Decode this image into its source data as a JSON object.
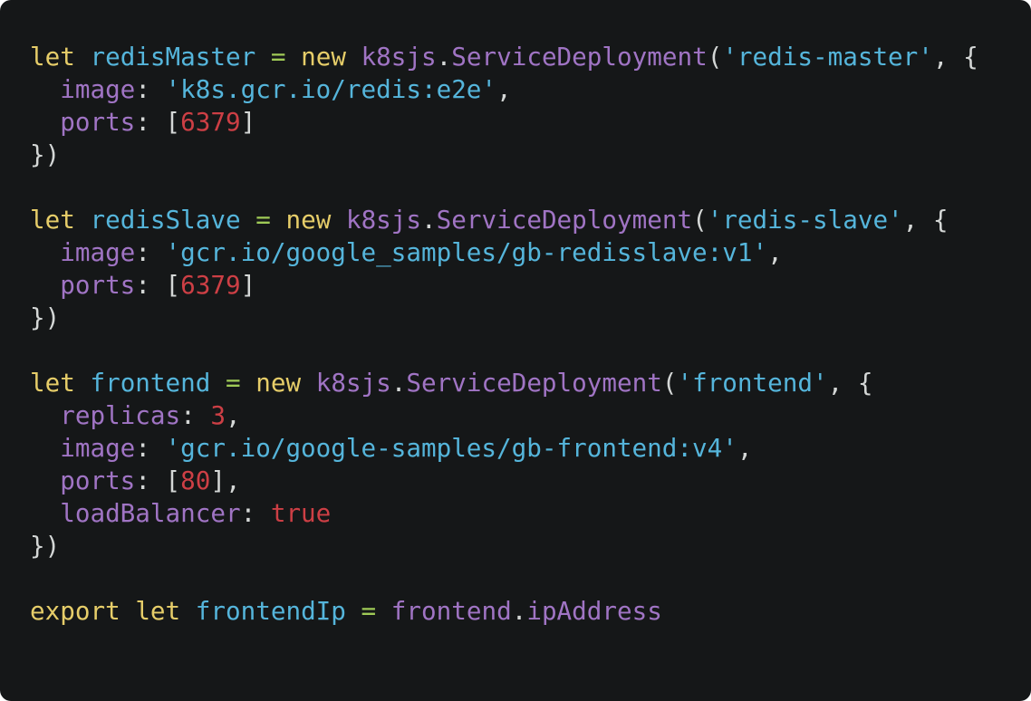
{
  "colors": {
    "background": "#151718",
    "keyword": "#e6cd69",
    "variable": "#55b5db",
    "namespace": "#a074c4",
    "property": "#a074c4",
    "string": "#55b5db",
    "number": "#cd3f45",
    "boolean": "#cd3f45",
    "punctuation": "#d4d7d6",
    "operator": "#9fca56"
  },
  "code": {
    "lines": [
      [
        {
          "t": "let",
          "k": "keyword"
        },
        {
          "t": " ",
          "k": "punctuation"
        },
        {
          "t": "redisMaster",
          "k": "variable"
        },
        {
          "t": " ",
          "k": "punctuation"
        },
        {
          "t": "=",
          "k": "operator"
        },
        {
          "t": " ",
          "k": "punctuation"
        },
        {
          "t": "new",
          "k": "keyword"
        },
        {
          "t": " ",
          "k": "punctuation"
        },
        {
          "t": "k8sjs",
          "k": "namespace"
        },
        {
          "t": ".",
          "k": "punctuation"
        },
        {
          "t": "ServiceDeployment",
          "k": "namespace"
        },
        {
          "t": "(",
          "k": "punctuation"
        },
        {
          "t": "'redis-master'",
          "k": "string"
        },
        {
          "t": ", {",
          "k": "punctuation"
        }
      ],
      [
        {
          "t": "  ",
          "k": "punctuation"
        },
        {
          "t": "image",
          "k": "property"
        },
        {
          "t": ": ",
          "k": "punctuation"
        },
        {
          "t": "'k8s.gcr.io/redis:e2e'",
          "k": "string"
        },
        {
          "t": ",",
          "k": "punctuation"
        }
      ],
      [
        {
          "t": "  ",
          "k": "punctuation"
        },
        {
          "t": "ports",
          "k": "property"
        },
        {
          "t": ": [",
          "k": "punctuation"
        },
        {
          "t": "6379",
          "k": "number"
        },
        {
          "t": "]",
          "k": "punctuation"
        }
      ],
      [
        {
          "t": "})",
          "k": "punctuation"
        }
      ],
      [],
      [
        {
          "t": "let",
          "k": "keyword"
        },
        {
          "t": " ",
          "k": "punctuation"
        },
        {
          "t": "redisSlave",
          "k": "variable"
        },
        {
          "t": " ",
          "k": "punctuation"
        },
        {
          "t": "=",
          "k": "operator"
        },
        {
          "t": " ",
          "k": "punctuation"
        },
        {
          "t": "new",
          "k": "keyword"
        },
        {
          "t": " ",
          "k": "punctuation"
        },
        {
          "t": "k8sjs",
          "k": "namespace"
        },
        {
          "t": ".",
          "k": "punctuation"
        },
        {
          "t": "ServiceDeployment",
          "k": "namespace"
        },
        {
          "t": "(",
          "k": "punctuation"
        },
        {
          "t": "'redis-slave'",
          "k": "string"
        },
        {
          "t": ", {",
          "k": "punctuation"
        }
      ],
      [
        {
          "t": "  ",
          "k": "punctuation"
        },
        {
          "t": "image",
          "k": "property"
        },
        {
          "t": ": ",
          "k": "punctuation"
        },
        {
          "t": "'gcr.io/google_samples/gb-redisslave:v1'",
          "k": "string"
        },
        {
          "t": ",",
          "k": "punctuation"
        }
      ],
      [
        {
          "t": "  ",
          "k": "punctuation"
        },
        {
          "t": "ports",
          "k": "property"
        },
        {
          "t": ": [",
          "k": "punctuation"
        },
        {
          "t": "6379",
          "k": "number"
        },
        {
          "t": "]",
          "k": "punctuation"
        }
      ],
      [
        {
          "t": "})",
          "k": "punctuation"
        }
      ],
      [],
      [
        {
          "t": "let",
          "k": "keyword"
        },
        {
          "t": " ",
          "k": "punctuation"
        },
        {
          "t": "frontend",
          "k": "variable"
        },
        {
          "t": " ",
          "k": "punctuation"
        },
        {
          "t": "=",
          "k": "operator"
        },
        {
          "t": " ",
          "k": "punctuation"
        },
        {
          "t": "new",
          "k": "keyword"
        },
        {
          "t": " ",
          "k": "punctuation"
        },
        {
          "t": "k8sjs",
          "k": "namespace"
        },
        {
          "t": ".",
          "k": "punctuation"
        },
        {
          "t": "ServiceDeployment",
          "k": "namespace"
        },
        {
          "t": "(",
          "k": "punctuation"
        },
        {
          "t": "'frontend'",
          "k": "string"
        },
        {
          "t": ", {",
          "k": "punctuation"
        }
      ],
      [
        {
          "t": "  ",
          "k": "punctuation"
        },
        {
          "t": "replicas",
          "k": "property"
        },
        {
          "t": ": ",
          "k": "punctuation"
        },
        {
          "t": "3",
          "k": "number"
        },
        {
          "t": ",",
          "k": "punctuation"
        }
      ],
      [
        {
          "t": "  ",
          "k": "punctuation"
        },
        {
          "t": "image",
          "k": "property"
        },
        {
          "t": ": ",
          "k": "punctuation"
        },
        {
          "t": "'gcr.io/google-samples/gb-frontend:v4'",
          "k": "string"
        },
        {
          "t": ",",
          "k": "punctuation"
        }
      ],
      [
        {
          "t": "  ",
          "k": "punctuation"
        },
        {
          "t": "ports",
          "k": "property"
        },
        {
          "t": ": [",
          "k": "punctuation"
        },
        {
          "t": "80",
          "k": "number"
        },
        {
          "t": "],",
          "k": "punctuation"
        }
      ],
      [
        {
          "t": "  ",
          "k": "punctuation"
        },
        {
          "t": "loadBalancer",
          "k": "property"
        },
        {
          "t": ": ",
          "k": "punctuation"
        },
        {
          "t": "true",
          "k": "boolean"
        }
      ],
      [
        {
          "t": "})",
          "k": "punctuation"
        }
      ],
      [],
      [
        {
          "t": "export",
          "k": "keyword"
        },
        {
          "t": " ",
          "k": "punctuation"
        },
        {
          "t": "let",
          "k": "keyword"
        },
        {
          "t": " ",
          "k": "punctuation"
        },
        {
          "t": "frontendIp",
          "k": "variable"
        },
        {
          "t": " ",
          "k": "punctuation"
        },
        {
          "t": "=",
          "k": "operator"
        },
        {
          "t": " ",
          "k": "punctuation"
        },
        {
          "t": "frontend",
          "k": "namespace"
        },
        {
          "t": ".",
          "k": "punctuation"
        },
        {
          "t": "ipAddress",
          "k": "namespace"
        }
      ]
    ]
  }
}
